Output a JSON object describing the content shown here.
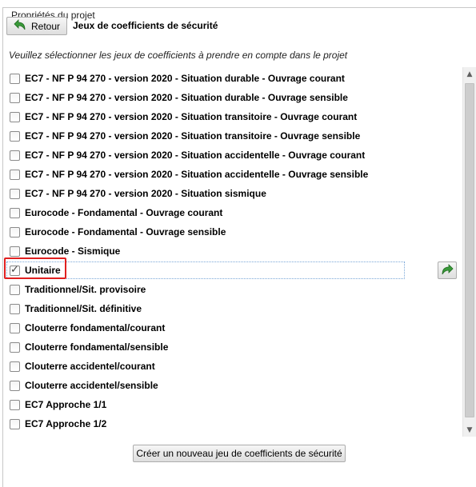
{
  "group_title": "Propriétés du projet",
  "header": {
    "back_label": "Retour",
    "title": "Jeux de coefficients de sécurité"
  },
  "instructions": "Veuillez sélectionner les jeux de coefficients à prendre en compte dans le projet",
  "items": [
    {
      "label": "EC7 - NF P 94 270 - version 2020 - Situation durable - Ouvrage courant",
      "checked": false
    },
    {
      "label": "EC7 - NF P 94 270 - version 2020 - Situation durable - Ouvrage sensible",
      "checked": false
    },
    {
      "label": "EC7 - NF P 94 270 - version 2020 - Situation transitoire - Ouvrage courant",
      "checked": false
    },
    {
      "label": "EC7 - NF P 94 270 - version 2020 - Situation transitoire - Ouvrage sensible",
      "checked": false
    },
    {
      "label": "EC7 - NF P 94 270 - version 2020 - Situation accidentelle - Ouvrage courant",
      "checked": false
    },
    {
      "label": "EC7 - NF P 94 270 - version 2020 - Situation accidentelle - Ouvrage sensible",
      "checked": false
    },
    {
      "label": "EC7 - NF P 94 270 - version 2020 - Situation sismique",
      "checked": false
    },
    {
      "label": "Eurocode - Fondamental - Ouvrage courant",
      "checked": false
    },
    {
      "label": "Eurocode - Fondamental - Ouvrage sensible",
      "checked": false
    },
    {
      "label": "Eurocode - Sismique",
      "checked": false
    },
    {
      "label": "Unitaire",
      "checked": true,
      "selected": true
    },
    {
      "label": "Traditionnel/Sit. provisoire",
      "checked": false
    },
    {
      "label": "Traditionnel/Sit. définitive",
      "checked": false
    },
    {
      "label": "Clouterre fondamental/courant",
      "checked": false
    },
    {
      "label": "Clouterre fondamental/sensible",
      "checked": false
    },
    {
      "label": "Clouterre accidentel/courant",
      "checked": false
    },
    {
      "label": "Clouterre accidentel/sensible",
      "checked": false
    },
    {
      "label": "EC7 Approche 1/1",
      "checked": false
    },
    {
      "label": "EC7 Approche 1/2",
      "checked": false
    }
  ],
  "create_button_label": "Créer un nouveau jeu de coefficients de sécurité",
  "colors": {
    "highlight": "#e02020",
    "arrow_green": "#3a9a3a"
  },
  "icons": {
    "back": "back-arrow-icon",
    "apply": "right-arrow-icon"
  }
}
